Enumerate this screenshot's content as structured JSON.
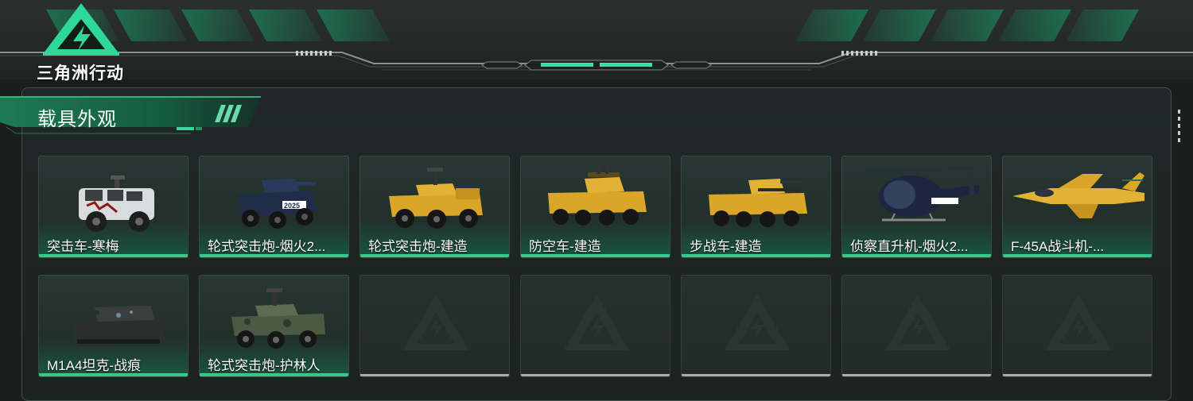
{
  "game": {
    "logo_text": "三角洲行动"
  },
  "section": {
    "title": "载具外观"
  },
  "colors": {
    "accent": "#35c98c",
    "empty_bar": "#a7adaa",
    "panel_bg": "#1f2826"
  },
  "vehicles": [
    {
      "name": "突击车-寒梅",
      "icon": "armored-jeep-icon"
    },
    {
      "name": "轮式突击炮-烟火2...",
      "icon": "wheeled-assault-gun-icon"
    },
    {
      "name": "轮式突击炮-建造",
      "icon": "wheeled-assault-gun-icon"
    },
    {
      "name": "防空车-建造",
      "icon": "anti-air-vehicle-icon"
    },
    {
      "name": "步战车-建造",
      "icon": "infantry-fighting-vehicle-icon"
    },
    {
      "name": "侦察直升机-烟火2...",
      "icon": "scout-helicopter-icon"
    },
    {
      "name": "F-45A战斗机-...",
      "icon": "fighter-jet-icon"
    },
    {
      "name": "M1A4坦克-战痕",
      "icon": "tank-icon"
    },
    {
      "name": "轮式突击炮-护林人",
      "icon": "wheeled-assault-gun-icon"
    },
    {
      "name": "",
      "icon": "empty-slot-icon"
    },
    {
      "name": "",
      "icon": "empty-slot-icon"
    },
    {
      "name": "",
      "icon": "empty-slot-icon"
    },
    {
      "name": "",
      "icon": "empty-slot-icon"
    },
    {
      "name": "",
      "icon": "empty-slot-icon"
    }
  ]
}
